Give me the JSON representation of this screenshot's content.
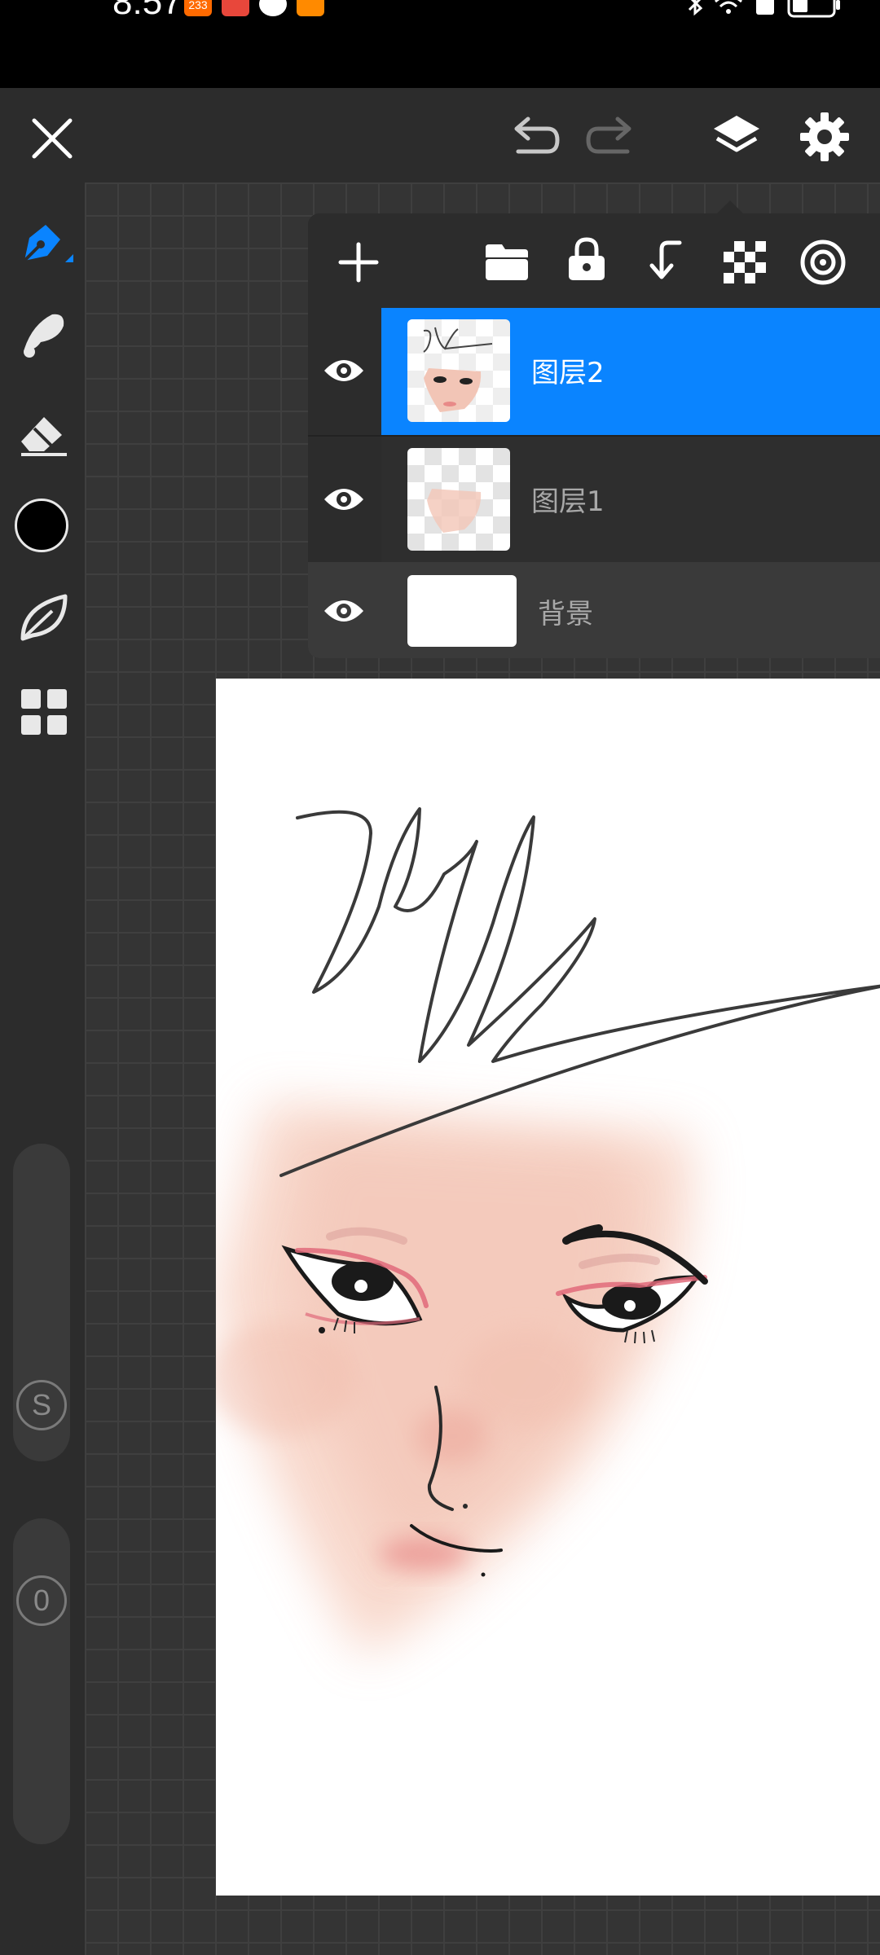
{
  "status_bar": {
    "time": "8:57",
    "notifications": [
      {
        "icon": "app-233-icon",
        "label": "233",
        "color": "#ff6a00"
      },
      {
        "icon": "app-huawei-icon",
        "label": "",
        "color": "#e8473b"
      },
      {
        "icon": "app-browser-icon",
        "label": "",
        "color": "#ffffff"
      },
      {
        "icon": "app-video-icon",
        "label": "",
        "color": "#ff8a00"
      }
    ]
  },
  "app_bar": {
    "close_icon": "close-icon",
    "undo_icon": "undo-icon",
    "redo_icon": "redo-icon",
    "layers_icon": "layers-icon",
    "settings_icon": "settings-icon"
  },
  "tools": [
    {
      "name": "pen-tool",
      "icon": "pen-icon",
      "active": true
    },
    {
      "name": "smudge-tool",
      "icon": "smudge-icon",
      "active": false
    },
    {
      "name": "eraser-tool",
      "icon": "eraser-icon",
      "active": false
    },
    {
      "name": "color-tool",
      "icon": "color-swatch-icon",
      "color": "#000000"
    },
    {
      "name": "leaf-tool",
      "icon": "leaf-icon",
      "active": false
    },
    {
      "name": "gallery-tool",
      "icon": "grid-icon",
      "active": false
    }
  ],
  "size_slider": {
    "label": "S"
  },
  "opacity_slider": {
    "label": "0"
  },
  "layers_panel": {
    "toolbar": [
      "add-icon",
      "folder-icon",
      "lock-icon",
      "merge-down-icon",
      "transparency-icon",
      "target-icon"
    ],
    "layers": [
      {
        "name": "图层2",
        "visible": true,
        "selected": true
      },
      {
        "name": "图层1",
        "visible": true,
        "selected": false
      },
      {
        "name": "背景",
        "visible": true,
        "selected": false
      }
    ]
  },
  "colors": {
    "accent": "#0a84ff",
    "toolbar_bg": "#2c2c2c",
    "canvas_bg": "#343434",
    "paper": "#ffffff"
  }
}
